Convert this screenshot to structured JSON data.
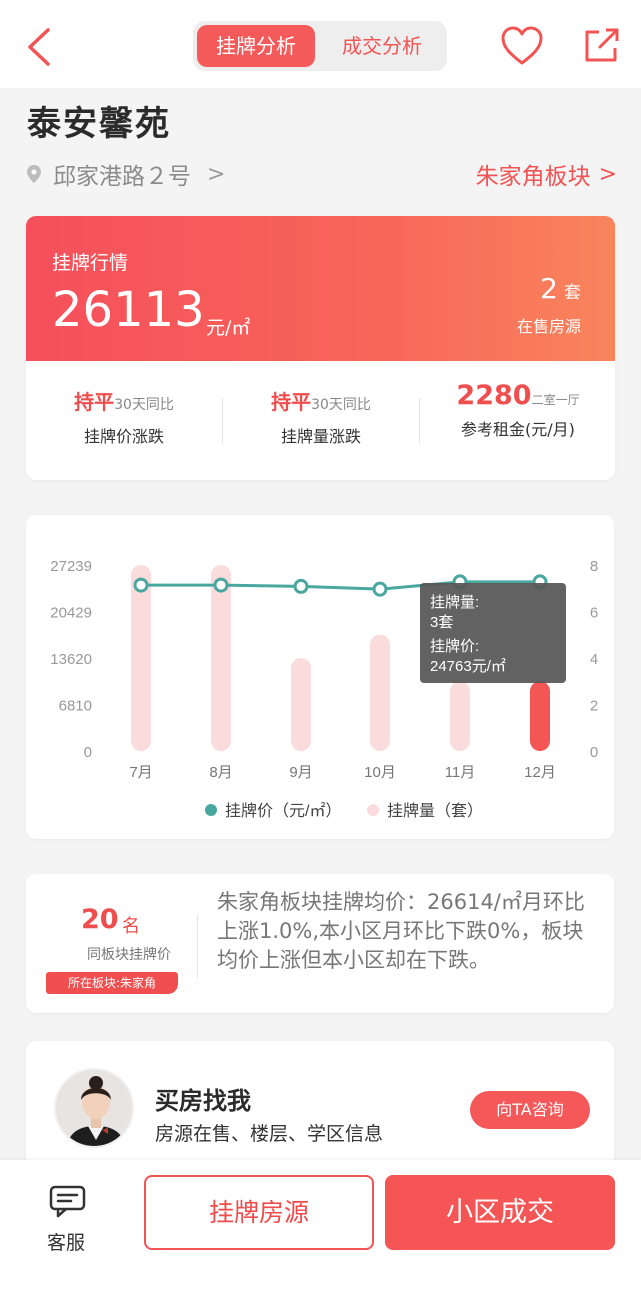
{
  "header": {
    "tabs": [
      {
        "label": "挂牌分析",
        "active": true
      },
      {
        "label": "成交分析",
        "active": false
      }
    ],
    "icons": [
      "back-arrow-icon",
      "heart-icon",
      "share-icon"
    ],
    "accent_color": "#f55a5a"
  },
  "community": {
    "name": "泰安馨苑",
    "address": "邱家港路２号",
    "address_chevron": ">",
    "district": "朱家角板块",
    "district_chevron": ">"
  },
  "market": {
    "label": "挂牌行情",
    "price": "26113",
    "price_unit": "元/㎡",
    "count": "2",
    "count_unit": "套",
    "count_label": "在售房源",
    "stats": [
      {
        "value": "持平",
        "note": "30天同比",
        "label": "挂牌价涨跌"
      },
      {
        "value": "持平",
        "note": "30天同比",
        "label": "挂牌量涨跌"
      },
      {
        "value": "2280",
        "note": "二室一厅",
        "label": "参考租金(元/月)"
      }
    ]
  },
  "chart_data": {
    "type": "bar+line",
    "categories": [
      "7月",
      "8月",
      "9月",
      "10月",
      "11月",
      "12月"
    ],
    "series": [
      {
        "name": "挂牌价（元/㎡）",
        "type": "line",
        "axis": "left",
        "color": "#4aa79f",
        "values": [
          24300,
          24300,
          24100,
          23700,
          24763,
          24763
        ]
      },
      {
        "name": "挂牌量（套）",
        "type": "bar",
        "axis": "right",
        "color": "#fbdcdc",
        "highlight_color": "#f45656",
        "values": [
          8,
          8,
          4,
          5,
          3,
          3
        ]
      }
    ],
    "left_ticks": [
      "27239",
      "20429",
      "13620",
      "6810",
      "0"
    ],
    "right_ticks": [
      "8",
      "6",
      "4",
      "2",
      "0"
    ],
    "ylim_left": [
      0,
      27239
    ],
    "ylim_right": [
      0,
      8
    ],
    "legend_position": "bottom",
    "highlight_index": 5,
    "tooltip": {
      "line1": "挂牌量:",
      "line2": "3套",
      "line3": "挂牌价:",
      "line4": "24763元/㎡"
    }
  },
  "ranking": {
    "rank": "20",
    "rank_unit": "名",
    "label": "同板块挂牌价",
    "tag": "所在板块:朱家角",
    "summary": "朱家角板块挂牌均价：26614/㎡月环比上涨1.0%,本小区月环比下跌0%，板块均价上涨但本小区却在下跌。"
  },
  "agent": {
    "title": "买房找我",
    "subtitle": "房源在售、楼层、学区信息",
    "button": "向TA咨询"
  },
  "footer": {
    "service_label": "客服",
    "btn_listings": "挂牌房源",
    "btn_deals": "小区成交"
  }
}
